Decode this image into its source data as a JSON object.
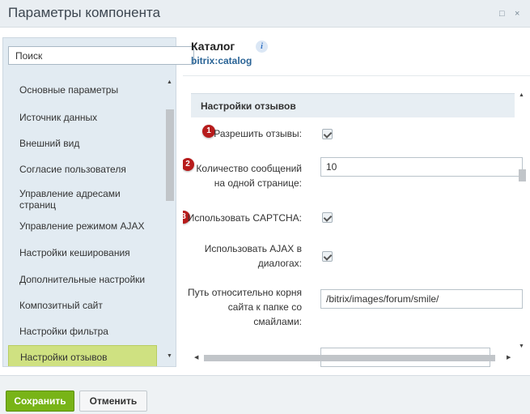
{
  "window": {
    "title": "Параметры компонента",
    "restore_glyph": "□",
    "close_glyph": "×"
  },
  "sidebar": {
    "search_value": "Поиск",
    "items": [
      {
        "label": "Основные параметры"
      },
      {
        "label": "Источник данных"
      },
      {
        "label": "Внешний вид"
      },
      {
        "label": "Согласие пользователя"
      },
      {
        "label": "Управление адресами страниц"
      },
      {
        "label": "Управление режимом AJAX"
      },
      {
        "label": "Настройки кеширования"
      },
      {
        "label": "Дополнительные настройки"
      },
      {
        "label": "Композитный сайт"
      },
      {
        "label": "Настройки фильтра"
      },
      {
        "label": "Настройки отзывов",
        "active": true
      }
    ]
  },
  "component": {
    "name": "Каталог",
    "code": "bitrix:catalog",
    "info_glyph": "i"
  },
  "section": {
    "title": "Настройки отзывов",
    "fields": [
      {
        "badge": "1",
        "label": "Разрешить отзывы:",
        "type": "checkbox",
        "checked": true
      },
      {
        "badge": "2",
        "label_line1": "Количество сообщений",
        "label_line2": "на одной странице:",
        "type": "text",
        "value": "10"
      },
      {
        "badge": "3",
        "label": "Использовать CAPTCHA:",
        "type": "checkbox",
        "checked": true
      },
      {
        "label_line1": "Использовать AJAX в",
        "label_line2": "диалогах:",
        "type": "checkbox",
        "checked": true
      },
      {
        "label_line1": "Путь относительно корня",
        "label_line2": "сайта к папке со",
        "label_line3": "смайлами:",
        "type": "text",
        "value": "/bitrix/images/forum/smile/"
      }
    ]
  },
  "footer": {
    "save_label": "Сохранить",
    "cancel_label": "Отменить"
  },
  "colors": {
    "accent_green": "#78b417",
    "active_item": "#cfe181",
    "badge_red": "#b71c1c",
    "link_blue": "#2a6496"
  }
}
